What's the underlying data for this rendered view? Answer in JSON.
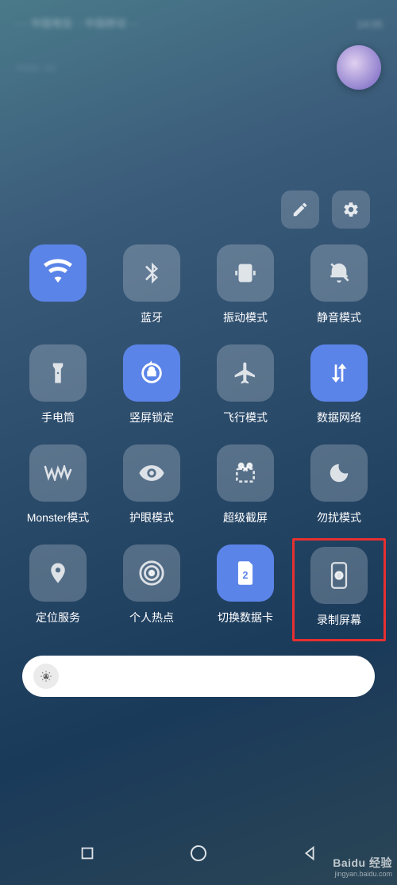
{
  "status": {
    "left": "···· 中国电信 ·· 中国移动 ···",
    "right": "14:05"
  },
  "header": {
    "left_text": "···· ··",
    "badge": "moon"
  },
  "controls": {
    "edit": "pencil-icon",
    "settings": "gear-icon"
  },
  "toggles": [
    {
      "id": "wifi",
      "label": "",
      "icon": "wifi-icon",
      "active": true
    },
    {
      "id": "bluetooth",
      "label": "蓝牙",
      "icon": "bluetooth-icon",
      "active": false
    },
    {
      "id": "vibrate",
      "label": "振动模式",
      "icon": "vibrate-icon",
      "active": false
    },
    {
      "id": "mute",
      "label": "静音模式",
      "icon": "mute-icon",
      "active": false
    },
    {
      "id": "flashlight",
      "label": "手电筒",
      "icon": "flashlight-icon",
      "active": false
    },
    {
      "id": "orientation",
      "label": "竖屏锁定",
      "icon": "rotation-lock-icon",
      "active": true
    },
    {
      "id": "airplane",
      "label": "飞行模式",
      "icon": "airplane-icon",
      "active": false
    },
    {
      "id": "data",
      "label": "数据网络",
      "icon": "data-sync-icon",
      "active": true
    },
    {
      "id": "monster",
      "label": "Monster模式",
      "icon": "monster-icon",
      "active": false
    },
    {
      "id": "eyecare",
      "label": "护眼模式",
      "icon": "eye-icon",
      "active": false
    },
    {
      "id": "screenshot",
      "label": "超级截屏",
      "icon": "scissors-icon",
      "active": false
    },
    {
      "id": "dnd",
      "label": "勿扰模式",
      "icon": "moon-crescent-icon",
      "active": false
    },
    {
      "id": "location",
      "label": "定位服务",
      "icon": "location-pin-icon",
      "active": false
    },
    {
      "id": "hotspot",
      "label": "个人热点",
      "icon": "hotspot-icon",
      "active": false
    },
    {
      "id": "simswap",
      "label": "切换数据卡",
      "icon": "sim-card-icon",
      "active": true
    },
    {
      "id": "record",
      "label": "录制屏幕",
      "icon": "record-screen-icon",
      "active": false,
      "highlighted": true
    }
  ],
  "brightness": {
    "auto_icon": "auto-brightness-icon"
  },
  "nav": {
    "recent": "square-icon",
    "home": "circle-icon",
    "back": "triangle-left-icon"
  },
  "watermark": {
    "main": "Baidu 经验",
    "sub": "jingyan.baidu.com"
  },
  "highlight_color": "#e63030",
  "active_color": "#5b84e8"
}
